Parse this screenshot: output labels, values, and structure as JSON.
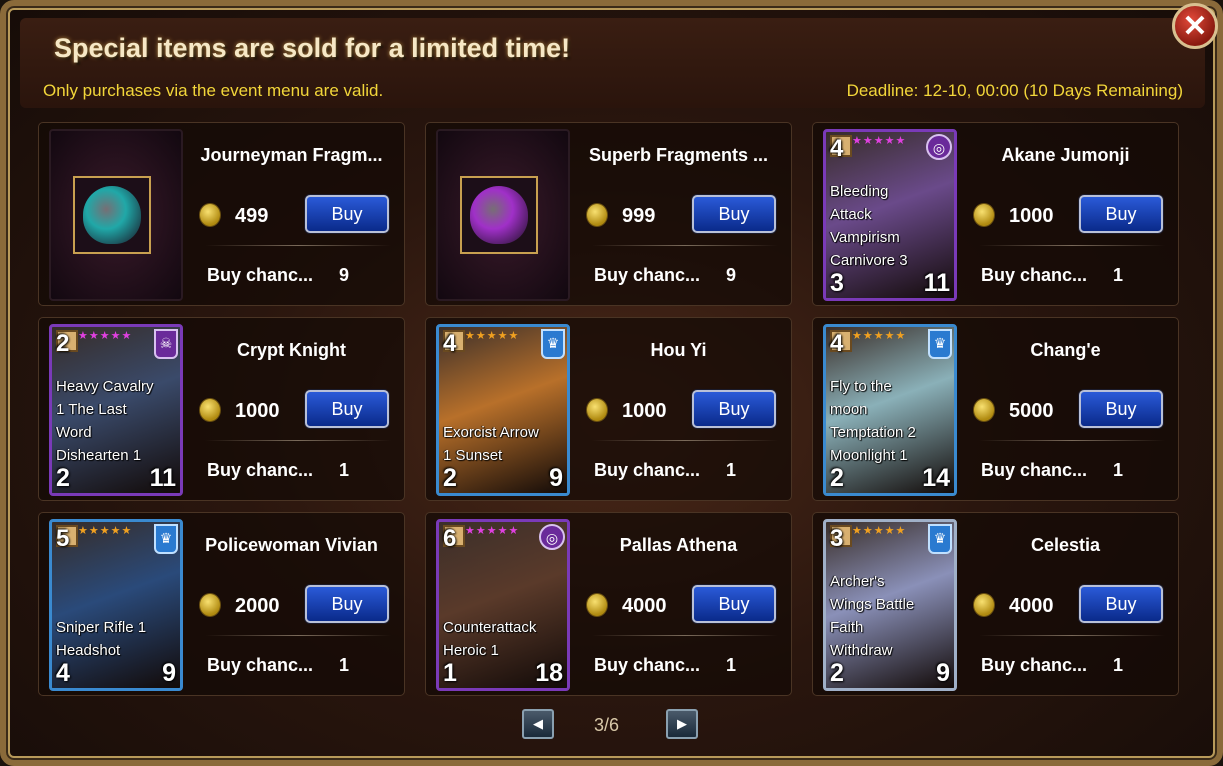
{
  "header": {
    "title": "Special items are sold for a limited time!",
    "subtitle": "Only purchases via the event menu are valid.",
    "deadline": "Deadline: 12-10, 00:00 (10 Days Remaining)",
    "close_icon": "close-icon"
  },
  "items": [
    {
      "name": "Journeyman Fragm...",
      "price": "499",
      "buy_label": "Buy",
      "chance_label": "Buy chanc...",
      "chance_value": "9",
      "type": "bag",
      "bag_color": "#20a8a8"
    },
    {
      "name": "Superb Fragments ...",
      "price": "999",
      "buy_label": "Buy",
      "chance_label": "Buy chanc...",
      "chance_value": "9",
      "type": "bag",
      "bag_color": "#a030c8"
    },
    {
      "name": "Akane Jumonji",
      "price": "1000",
      "buy_label": "Buy",
      "chance_label": "Buy chanc...",
      "chance_value": "1",
      "type": "hero",
      "cost": "4",
      "skills": [
        "Bleeding",
        "Attack",
        "Vampirism",
        "Carnivore 3"
      ],
      "atk": "3",
      "hp": "11",
      "rarity": "purple",
      "badge": "swirl",
      "art_color": "#6a4a8a"
    },
    {
      "name": "Crypt Knight",
      "price": "1000",
      "buy_label": "Buy",
      "chance_label": "Buy chanc...",
      "chance_value": "1",
      "type": "hero",
      "cost": "2",
      "skills": [
        "Heavy Cavalry",
        "1 The Last",
        "Word",
        "Dishearten 1"
      ],
      "atk": "2",
      "hp": "11",
      "rarity": "purple",
      "badge": "skull",
      "art_color": "#3a4a6a"
    },
    {
      "name": "Hou Yi",
      "price": "1000",
      "buy_label": "Buy",
      "chance_label": "Buy chanc...",
      "chance_value": "1",
      "type": "hero",
      "cost": "4",
      "skills": [
        "Exorcist Arrow",
        "1 Sunset"
      ],
      "atk": "2",
      "hp": "9",
      "rarity": "blue",
      "badge": "crown",
      "art_color": "#b8702a"
    },
    {
      "name": "Chang'e",
      "price": "5000",
      "buy_label": "Buy",
      "chance_label": "Buy chanc...",
      "chance_value": "1",
      "type": "hero",
      "cost": "4",
      "skills": [
        "Fly to the",
        "moon",
        "Temptation 2",
        "Moonlight 1"
      ],
      "atk": "2",
      "hp": "14",
      "rarity": "blue",
      "badge": "crown",
      "art_color": "#8ab0b8"
    },
    {
      "name": "Policewoman Vivian",
      "price": "2000",
      "buy_label": "Buy",
      "chance_label": "Buy chanc...",
      "chance_value": "1",
      "type": "hero",
      "cost": "5",
      "skills": [
        "Sniper Rifle 1",
        "Headshot"
      ],
      "atk": "4",
      "hp": "9",
      "rarity": "blue",
      "badge": "crown",
      "art_color": "#2a4a7a"
    },
    {
      "name": "Pallas Athena",
      "price": "4000",
      "buy_label": "Buy",
      "chance_label": "Buy chanc...",
      "chance_value": "1",
      "type": "hero",
      "cost": "6",
      "skills": [
        "Counterattack",
        "Heroic 1"
      ],
      "atk": "1",
      "hp": "18",
      "rarity": "purple",
      "badge": "swirl",
      "art_color": "#5a3a2a"
    },
    {
      "name": "Celestia",
      "price": "4000",
      "buy_label": "Buy",
      "chance_label": "Buy chanc...",
      "chance_value": "1",
      "type": "hero",
      "cost": "3",
      "skills": [
        "Archer's",
        "Wings Battle",
        "Faith",
        "Withdraw"
      ],
      "atk": "2",
      "hp": "9",
      "rarity": "silver",
      "badge": "crown",
      "art_color": "#8a90b8"
    }
  ],
  "pager": {
    "prev_icon": "prev-page-icon",
    "next_icon": "next-page-icon",
    "prev_glyph": "◀",
    "next_glyph": "▶",
    "text": "3/6"
  }
}
